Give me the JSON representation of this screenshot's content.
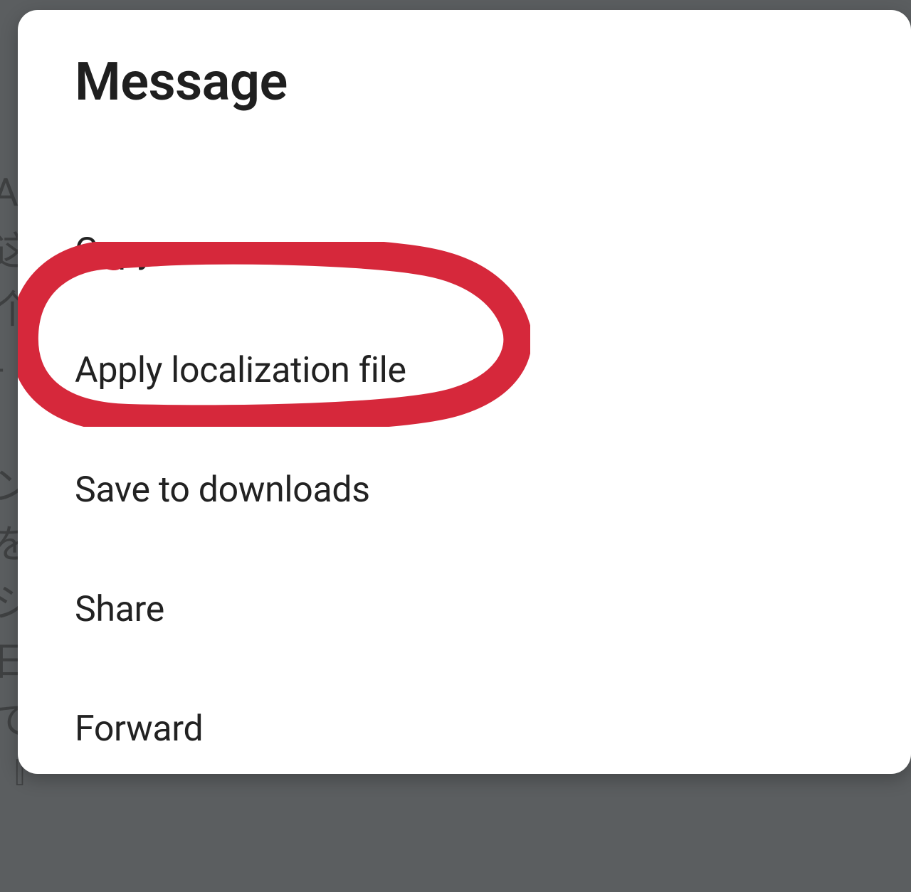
{
  "dialog": {
    "title": "Message",
    "items": [
      {
        "label": "Copy"
      },
      {
        "label": "Apply localization file"
      },
      {
        "label": "Save to downloads"
      },
      {
        "label": "Share"
      },
      {
        "label": "Forward"
      }
    ]
  },
  "annotation": {
    "highlighted_index": 1,
    "stroke_color": "#d6283b"
  }
}
